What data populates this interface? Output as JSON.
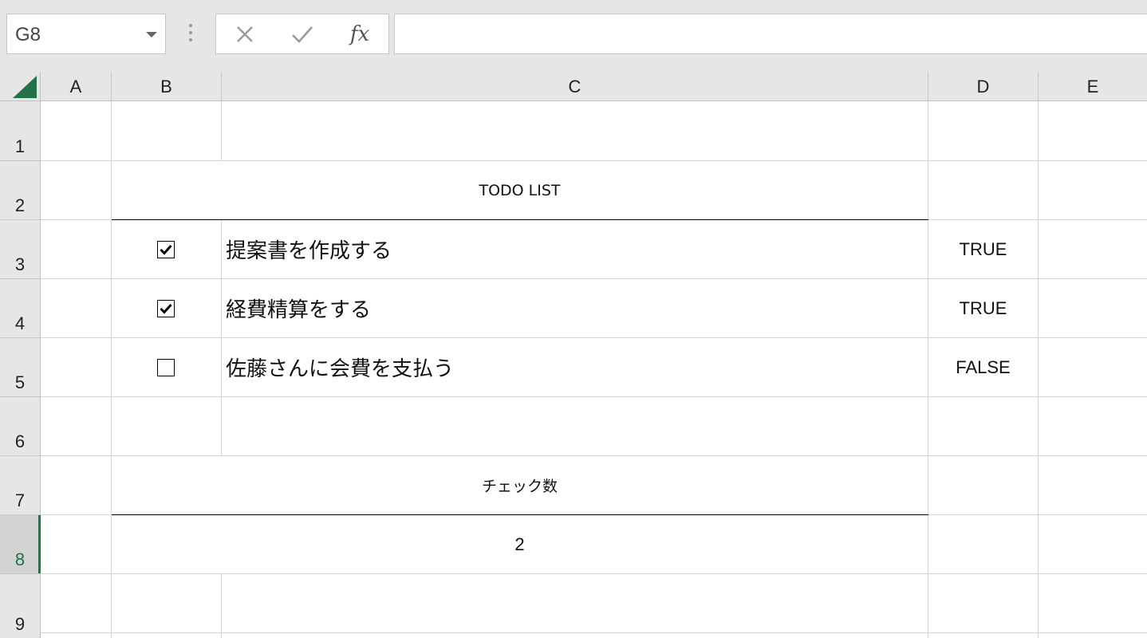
{
  "formula_bar": {
    "name_box_value": "G8",
    "cancel_icon": "close-icon",
    "enter_icon": "check-icon",
    "function_label": "fx",
    "formula_value": ""
  },
  "columns": [
    "A",
    "B",
    "C",
    "D",
    "E"
  ],
  "rows": [
    "1",
    "2",
    "3",
    "4",
    "5",
    "6",
    "7",
    "8",
    "9"
  ],
  "active_cell": "G8",
  "sheet": {
    "title": "TODO LIST",
    "tasks": [
      {
        "checked": true,
        "label": "提案書を作成する",
        "value": "TRUE"
      },
      {
        "checked": true,
        "label": "経費精算をする",
        "value": "TRUE"
      },
      {
        "checked": false,
        "label": "佐藤さんに会費を支払う",
        "value": "FALSE"
      }
    ],
    "count_label": "チェック数",
    "count_value": "2"
  },
  "colors": {
    "accent": "#217346",
    "header_bg": "#e6e6e6",
    "grid_line": "#d4d4d4"
  }
}
